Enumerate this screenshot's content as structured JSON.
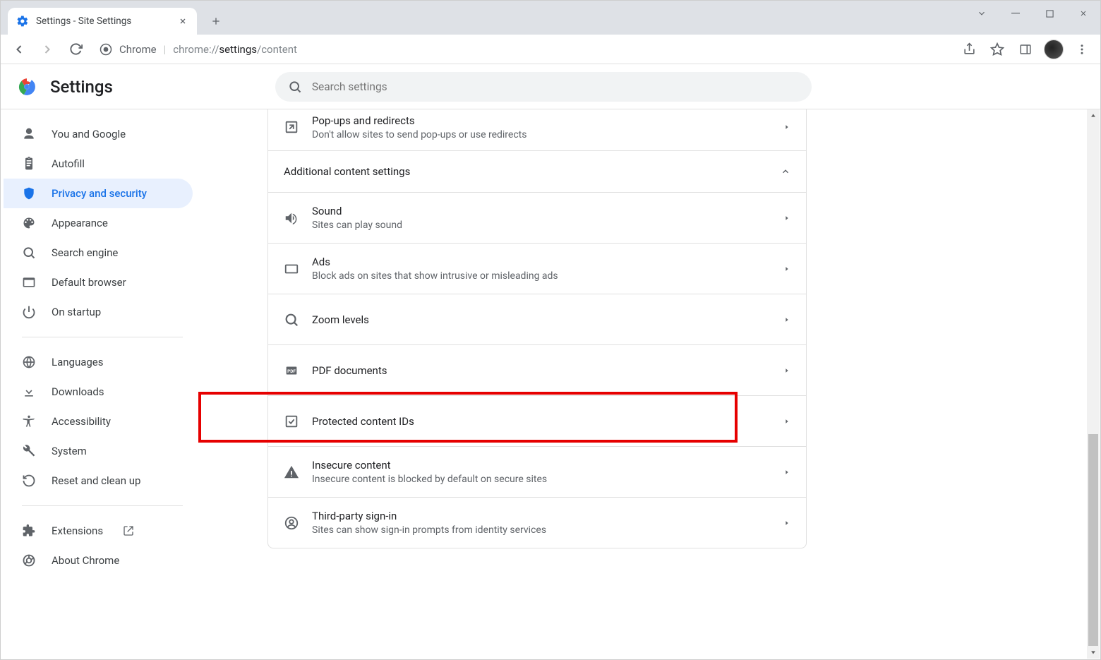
{
  "tab": {
    "title": "Settings - Site Settings"
  },
  "omnibox": {
    "origin": "Chrome",
    "url_prefix": "chrome://",
    "url_bold": "settings",
    "url_rest": "/content"
  },
  "settings": {
    "title": "Settings",
    "search_placeholder": "Search settings"
  },
  "sidebar": {
    "items": [
      {
        "label": "You and Google"
      },
      {
        "label": "Autofill"
      },
      {
        "label": "Privacy and security"
      },
      {
        "label": "Appearance"
      },
      {
        "label": "Search engine"
      },
      {
        "label": "Default browser"
      },
      {
        "label": "On startup"
      }
    ],
    "items2": [
      {
        "label": "Languages"
      },
      {
        "label": "Downloads"
      },
      {
        "label": "Accessibility"
      },
      {
        "label": "System"
      },
      {
        "label": "Reset and clean up"
      }
    ],
    "items3": [
      {
        "label": "Extensions"
      },
      {
        "label": "About Chrome"
      }
    ]
  },
  "content": {
    "popups": {
      "title": "Pop-ups and redirects",
      "sub": "Don't allow sites to send pop-ups or use redirects"
    },
    "section": "Additional content settings",
    "sound": {
      "title": "Sound",
      "sub": "Sites can play sound"
    },
    "ads": {
      "title": "Ads",
      "sub": "Block ads on sites that show intrusive or misleading ads"
    },
    "zoom": {
      "title": "Zoom levels"
    },
    "pdf": {
      "title": "PDF documents"
    },
    "protected": {
      "title": "Protected content IDs"
    },
    "insecure": {
      "title": "Insecure content",
      "sub": "Insecure content is blocked by default on secure sites"
    },
    "thirdparty": {
      "title": "Third-party sign-in",
      "sub": "Sites can show sign-in prompts from identity services"
    }
  }
}
